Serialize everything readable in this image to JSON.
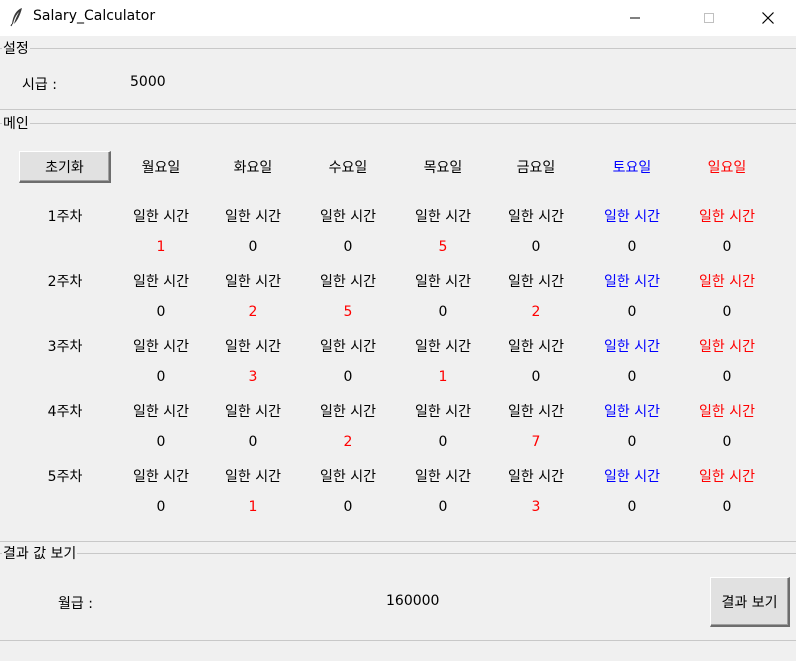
{
  "window": {
    "title": "Salary_Calculator",
    "icon": "feather-icon",
    "controls": [
      "minimize-icon",
      "maximize-icon",
      "close-icon"
    ]
  },
  "settings": {
    "legend": "설정",
    "wage_label": "시급 :",
    "wage_value": "5000"
  },
  "main": {
    "legend": "메인",
    "reset_label": "초기화",
    "days": [
      {
        "label": "월요일",
        "color": "#000000"
      },
      {
        "label": "화요일",
        "color": "#000000"
      },
      {
        "label": "수요일",
        "color": "#000000"
      },
      {
        "label": "목요일",
        "color": "#000000"
      },
      {
        "label": "금요일",
        "color": "#000000"
      },
      {
        "label": "토요일",
        "color": "#0000ff"
      },
      {
        "label": "일요일",
        "color": "#ff0000"
      }
    ],
    "hours_label": "일한 시간",
    "weeks": [
      {
        "label": "1주차",
        "hours": [
          "1",
          "0",
          "0",
          "5",
          "0",
          "0",
          "0"
        ]
      },
      {
        "label": "2주차",
        "hours": [
          "0",
          "2",
          "5",
          "0",
          "2",
          "0",
          "0"
        ]
      },
      {
        "label": "3주차",
        "hours": [
          "0",
          "3",
          "0",
          "1",
          "0",
          "0",
          "0"
        ]
      },
      {
        "label": "4주차",
        "hours": [
          "0",
          "0",
          "2",
          "0",
          "7",
          "0",
          "0"
        ]
      },
      {
        "label": "5주차",
        "hours": [
          "0",
          "1",
          "0",
          "0",
          "3",
          "0",
          "0"
        ]
      }
    ],
    "nonzero_color": "#ff0000",
    "zero_color": "#000000"
  },
  "result": {
    "legend": "결과 값 보기",
    "salary_label": "월급 :",
    "salary_value": "160000",
    "show_button": "결과 보기"
  }
}
